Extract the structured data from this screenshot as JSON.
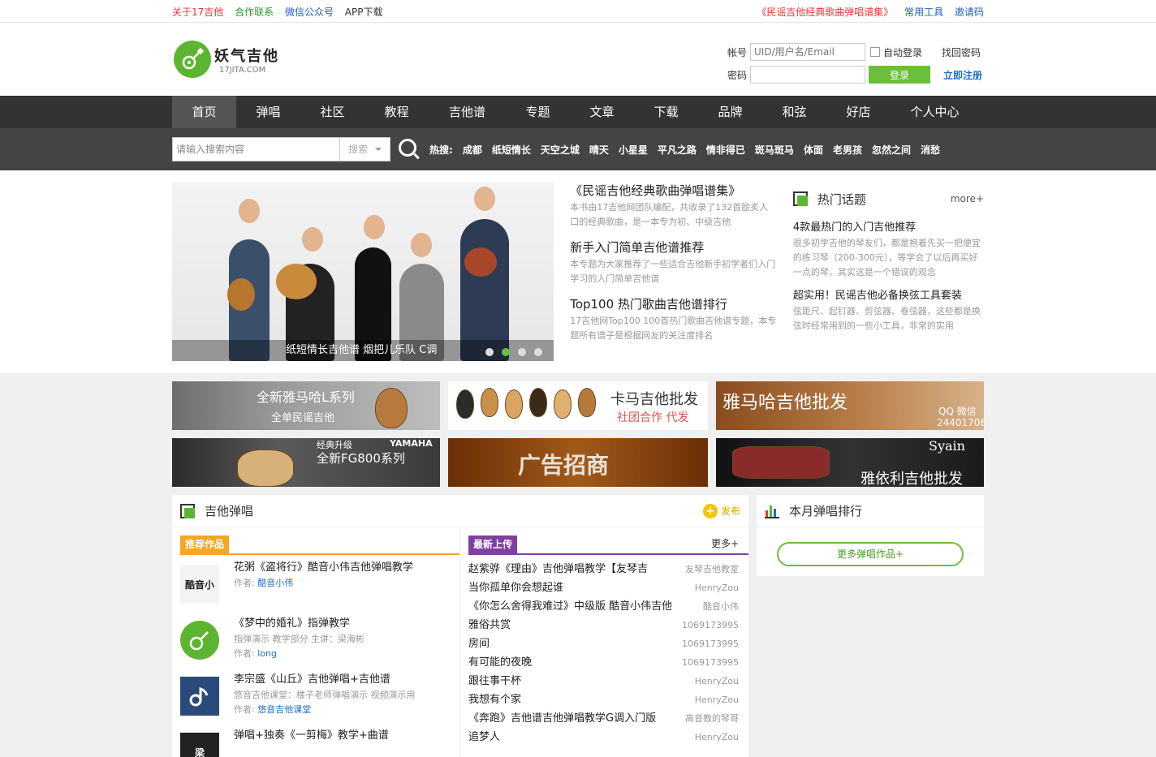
{
  "topbar": {
    "links_left": [
      "关于17吉他",
      "合作联系",
      "微信公众号",
      "APP下载"
    ],
    "links_right": [
      "《民谣吉他经典歌曲弹唱谱集》",
      "常用工具",
      "邀请码"
    ]
  },
  "logo": {
    "cn": "妖气吉他",
    "en": "17JITA.COM"
  },
  "login": {
    "account_label": "帐号",
    "account_placeholder": "UID/用户名/Email",
    "password_label": "密码",
    "auto_login": "自动登录",
    "find_password": "找回密码",
    "login_button": "登录",
    "register": "立即注册"
  },
  "nav": [
    "首页",
    "弹唱",
    "社区",
    "教程",
    "吉他谱",
    "专题",
    "文章",
    "下载",
    "品牌",
    "和弦",
    "好店",
    "个人中心"
  ],
  "search": {
    "placeholder": "请输入搜索内容",
    "select": "搜索",
    "hot_label": "热搜:",
    "hot_items": [
      "成都",
      "纸短情长",
      "天空之城",
      "晴天",
      "小星星",
      "平凡之路",
      "情非得已",
      "斑马斑马",
      "体面",
      "老男孩",
      "忽然之间",
      "消愁"
    ]
  },
  "banner": {
    "caption": "纸短情长吉他谱 烟把儿乐队 C调"
  },
  "features": [
    {
      "title": "《民谣吉他经典歌曲弹唱谱集》",
      "desc": "本书由17吉他网团队编配，共收录了132首脍炙人口的经典歌曲，是一本专为初、中级吉他"
    },
    {
      "title": "新手入门简单吉他谱推荐",
      "desc": "本专题为大家推荐了一些适合吉他新手初学者们入门学习的入门简单吉他谱"
    },
    {
      "title": "Top100 热门歌曲吉他谱排行",
      "desc": "17吉他网Top100 100首热门歌曲吉他谱专题，本专题所有谱子是根据网友的关注度排名"
    }
  ],
  "hot_topics": {
    "title": "热门话题",
    "more": "more+",
    "items": [
      {
        "title": "4款最热门的入门吉他推荐",
        "desc": "很多初学吉他的琴友们，都是抱着先买一把便宜的练习琴（200-300元），等学会了以后再买好一点的琴，其实这是一个错误的观念"
      },
      {
        "title": "超实用！民谣吉他必备换弦工具套装",
        "desc": "弦距尺、起钉器、剪弦器、卷弦器，这些都是换弦时经常用到的一些小工具，非常的实用"
      }
    ]
  },
  "ads": {
    "ad1": {
      "l1": "全新雅马哈L系列",
      "l2": "全单民谣吉他"
    },
    "ad2": {
      "l1": "卡马吉他批发",
      "l2": "社团合作 代发"
    },
    "ad3": {
      "l1": "雅马哈吉他批发",
      "l2": "QQ 微信",
      "l3": "24401706"
    },
    "ad4": {
      "l1": "经典升级",
      "l2": "全新FG800系列",
      "l3": "YAMAHA"
    },
    "ad5": {
      "l1": "广告招商"
    },
    "ad6": {
      "l1": "雅依利吉他批发",
      "l2": "Syain"
    }
  },
  "strum": {
    "title": "吉他弹唱",
    "publish": "发布",
    "recommend_tag": "推荐作品",
    "author_label": "作者:",
    "recommend": [
      {
        "title": "花粥《盗将行》酷音小伟吉他弹唱教学",
        "desc": "",
        "author": "酷音小伟",
        "thumb": "酷音小"
      },
      {
        "title": "《梦中的婚礼》指弹教学",
        "desc": "指弹演示 教学部分 主讲：梁海彬",
        "author": "long",
        "thumb": ""
      },
      {
        "title": "李宗盛《山丘》吉他弹唱+吉他谱",
        "desc": "悠音吉他课堂：楼子老师弹唱演示 视频演示用",
        "author": "悠音吉他课堂",
        "thumb": ""
      },
      {
        "title": "弹唱+独奏《一剪梅》教学+曲谱",
        "desc": "",
        "author": "",
        "thumb": "梁"
      }
    ],
    "upload_tag": "最新上传",
    "upload_more": "更多+",
    "uploads": [
      {
        "title": "赵紫骅《理由》吉他弹唱教学【友琴吉",
        "user": "友琴吉他教室"
      },
      {
        "title": "当你孤单你会想起谁",
        "user": "HenryZou"
      },
      {
        "title": "《你怎么舍得我难过》中级版 酷音小伟吉他",
        "user": "酷音小伟"
      },
      {
        "title": "雅俗共赏",
        "user": "1069173995"
      },
      {
        "title": "房间",
        "user": "1069173995"
      },
      {
        "title": "有可能的夜晚",
        "user": "1069173995"
      },
      {
        "title": "跟往事干杯",
        "user": "HenryZou"
      },
      {
        "title": "我想有个家",
        "user": "HenryZou"
      },
      {
        "title": "《奔跑》吉他谱吉他弹唱教学G调入门版",
        "user": "高音教的琴哥"
      },
      {
        "title": "追梦人",
        "user": "HenryZou"
      }
    ]
  },
  "rank": {
    "title": "本月弹唱排行",
    "more": "更多弹唱作品+"
  },
  "colors": {
    "accent": "#6bbf3a",
    "nav_bg": "#333333",
    "search_bg": "#444444",
    "link_blue": "#1f6fc7",
    "red": "#e4393c"
  }
}
